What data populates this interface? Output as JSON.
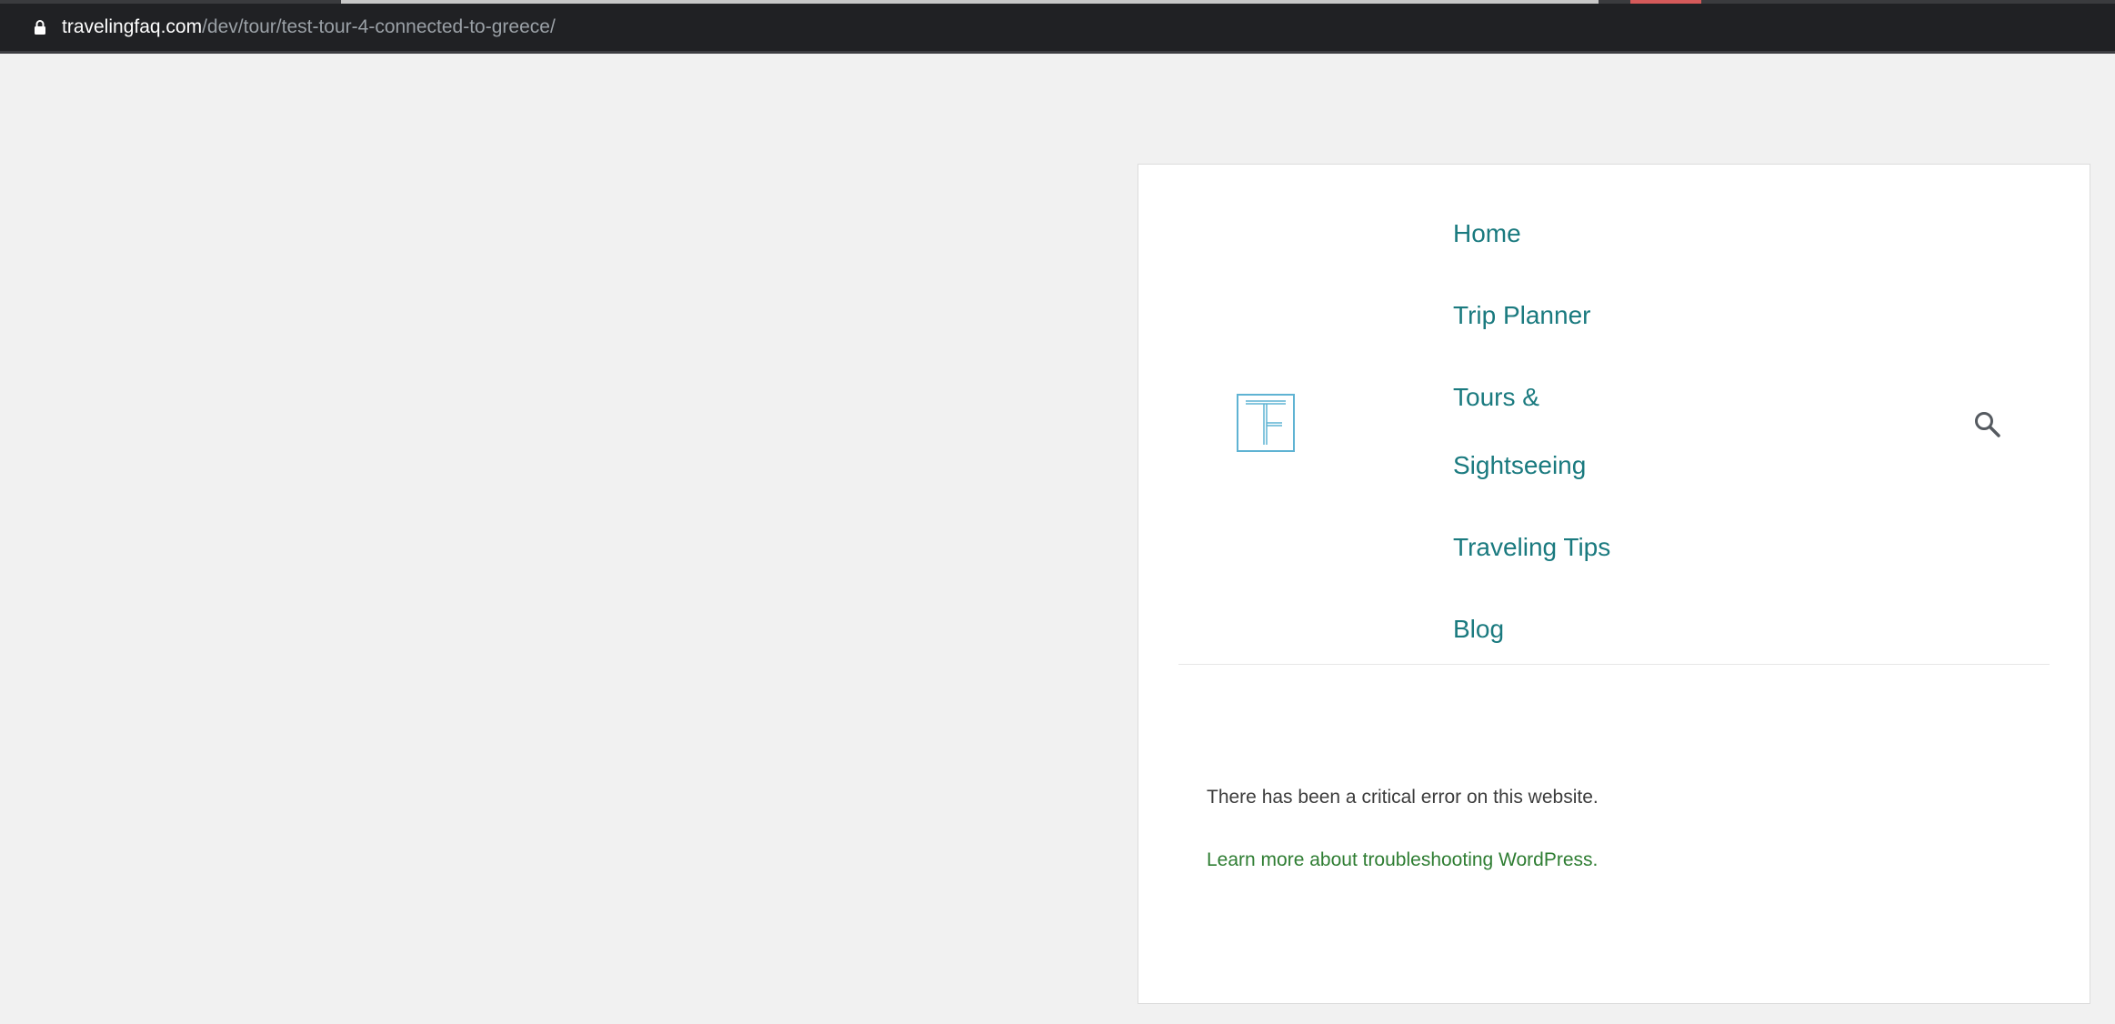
{
  "browser": {
    "url_domain": "travelingfaq.com",
    "url_path": "/dev/tour/test-tour-4-connected-to-greece/"
  },
  "site": {
    "logo_letter": "F",
    "nav": [
      {
        "label": "Home"
      },
      {
        "label": "Trip Planner"
      },
      {
        "label": "Tours & Sightseeing"
      },
      {
        "label": "Traveling Tips"
      },
      {
        "label": "Blog"
      }
    ]
  },
  "content": {
    "error_message": "There has been a critical error on this website.",
    "help_link": "Learn more about troubleshooting WordPress."
  },
  "colors": {
    "nav_link": "#1a7a7f",
    "help_link": "#2e7d32",
    "logo": "#5fb3d3"
  }
}
